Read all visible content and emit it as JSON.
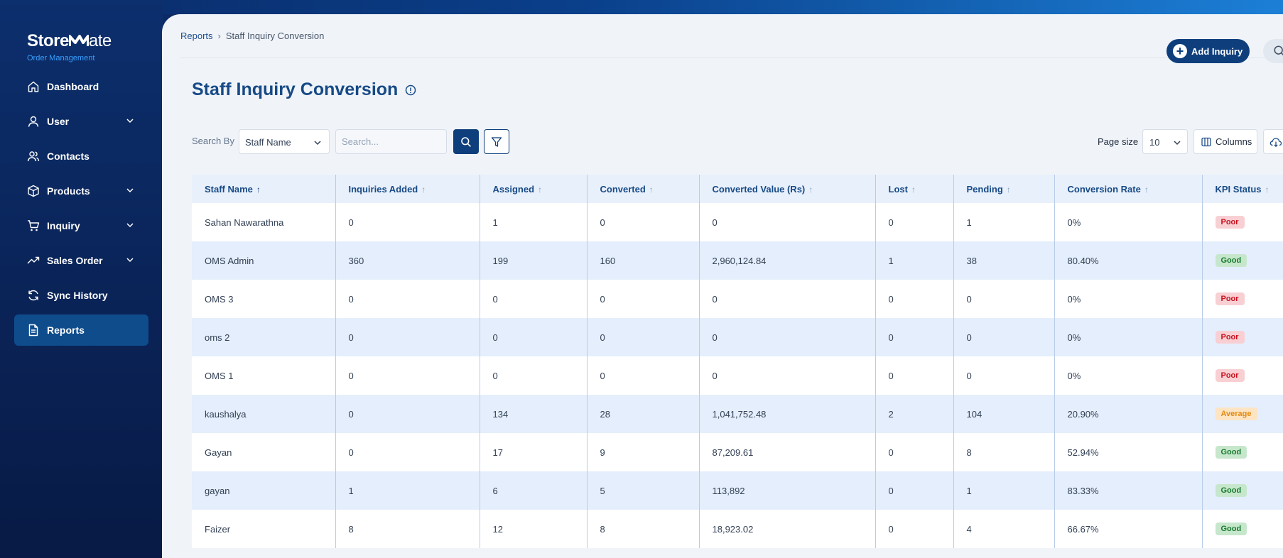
{
  "sidebar": {
    "logo_bold": "Store",
    "logo_light": "ate",
    "subtitle": "Order Management",
    "items": [
      {
        "label": "Dashboard",
        "icon": "home-icon",
        "has_chevron": false,
        "active": false
      },
      {
        "label": "User",
        "icon": "user-icon",
        "has_chevron": true,
        "active": false
      },
      {
        "label": "Contacts",
        "icon": "contacts-icon",
        "has_chevron": false,
        "active": false
      },
      {
        "label": "Products",
        "icon": "box-icon",
        "has_chevron": true,
        "active": false
      },
      {
        "label": "Inquiry",
        "icon": "cart-icon",
        "has_chevron": true,
        "active": false
      },
      {
        "label": "Sales Order",
        "icon": "trend-icon",
        "has_chevron": true,
        "active": false
      },
      {
        "label": "Sync History",
        "icon": "sync-icon",
        "has_chevron": false,
        "active": false
      },
      {
        "label": "Reports",
        "icon": "report-icon",
        "has_chevron": false,
        "active": true
      }
    ]
  },
  "header": {
    "breadcrumb_root": "Reports",
    "breadcrumb_current": "Staff Inquiry Conversion",
    "add_button": "Add Inquiry"
  },
  "page": {
    "title": "Staff Inquiry Conversion"
  },
  "toolbar": {
    "search_by_label": "Search By",
    "search_by_value": "Staff Name",
    "search_placeholder": "Search...",
    "page_size_label": "Page size",
    "page_size_value": "10",
    "columns_label": "Columns"
  },
  "table": {
    "columns": [
      {
        "label": "Staff Name",
        "sorted": true
      },
      {
        "label": "Inquiries Added",
        "sorted": false
      },
      {
        "label": "Assigned",
        "sorted": false
      },
      {
        "label": "Converted",
        "sorted": false
      },
      {
        "label": "Converted Value (Rs)",
        "sorted": false
      },
      {
        "label": "Lost",
        "sorted": false
      },
      {
        "label": "Pending",
        "sorted": false
      },
      {
        "label": "Conversion Rate",
        "sorted": false
      },
      {
        "label": "KPI Status",
        "sorted": false
      }
    ],
    "rows": [
      {
        "staff": "Sahan Nawarathna",
        "added": "0",
        "assigned": "1",
        "converted": "0",
        "value": "0",
        "lost": "0",
        "pending": "1",
        "rate": "0%",
        "kpi": "Poor"
      },
      {
        "staff": "OMS Admin",
        "added": "360",
        "assigned": "199",
        "converted": "160",
        "value": "2,960,124.84",
        "lost": "1",
        "pending": "38",
        "rate": "80.40%",
        "kpi": "Good"
      },
      {
        "staff": "OMS 3",
        "added": "0",
        "assigned": "0",
        "converted": "0",
        "value": "0",
        "lost": "0",
        "pending": "0",
        "rate": "0%",
        "kpi": "Poor"
      },
      {
        "staff": "oms 2",
        "added": "0",
        "assigned": "0",
        "converted": "0",
        "value": "0",
        "lost": "0",
        "pending": "0",
        "rate": "0%",
        "kpi": "Poor"
      },
      {
        "staff": "OMS 1",
        "added": "0",
        "assigned": "0",
        "converted": "0",
        "value": "0",
        "lost": "0",
        "pending": "0",
        "rate": "0%",
        "kpi": "Poor"
      },
      {
        "staff": "kaushalya",
        "added": "0",
        "assigned": "134",
        "converted": "28",
        "value": "1,041,752.48",
        "lost": "2",
        "pending": "104",
        "rate": "20.90%",
        "kpi": "Average"
      },
      {
        "staff": "Gayan",
        "added": "0",
        "assigned": "17",
        "converted": "9",
        "value": "87,209.61",
        "lost": "0",
        "pending": "8",
        "rate": "52.94%",
        "kpi": "Good"
      },
      {
        "staff": "gayan",
        "added": "1",
        "assigned": "6",
        "converted": "5",
        "value": "113,892",
        "lost": "0",
        "pending": "1",
        "rate": "83.33%",
        "kpi": "Good"
      },
      {
        "staff": "Faizer",
        "added": "8",
        "assigned": "12",
        "converted": "8",
        "value": "18,923.02",
        "lost": "0",
        "pending": "4",
        "rate": "66.67%",
        "kpi": "Good"
      }
    ]
  }
}
